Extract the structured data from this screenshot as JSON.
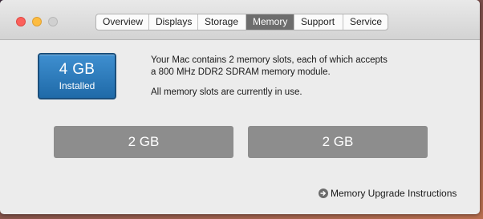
{
  "tabs": [
    {
      "label": "Overview"
    },
    {
      "label": "Displays"
    },
    {
      "label": "Storage"
    },
    {
      "label": "Memory"
    },
    {
      "label": "Support"
    },
    {
      "label": "Service"
    }
  ],
  "active_tab": "Memory",
  "memory": {
    "installed_size": "4 GB",
    "installed_label": "Installed",
    "description": "Your Mac contains 2 memory slots, each of which accepts a 800 MHz DDR2 SDRAM memory module.",
    "description_line1": "Your Mac contains 2 memory slots, each of which accepts",
    "description_line2": "a 800 MHz DDR2 SDRAM memory module.",
    "status": "All memory slots are currently in use."
  },
  "slots": [
    {
      "label": "2 GB"
    },
    {
      "label": "2 GB"
    }
  ],
  "upgrade_link": "Memory Upgrade Instructions",
  "colors": {
    "badge_blue": "#2b7bbd",
    "slot_gray": "#8d8d8d",
    "active_tab": "#6d6d6d"
  }
}
